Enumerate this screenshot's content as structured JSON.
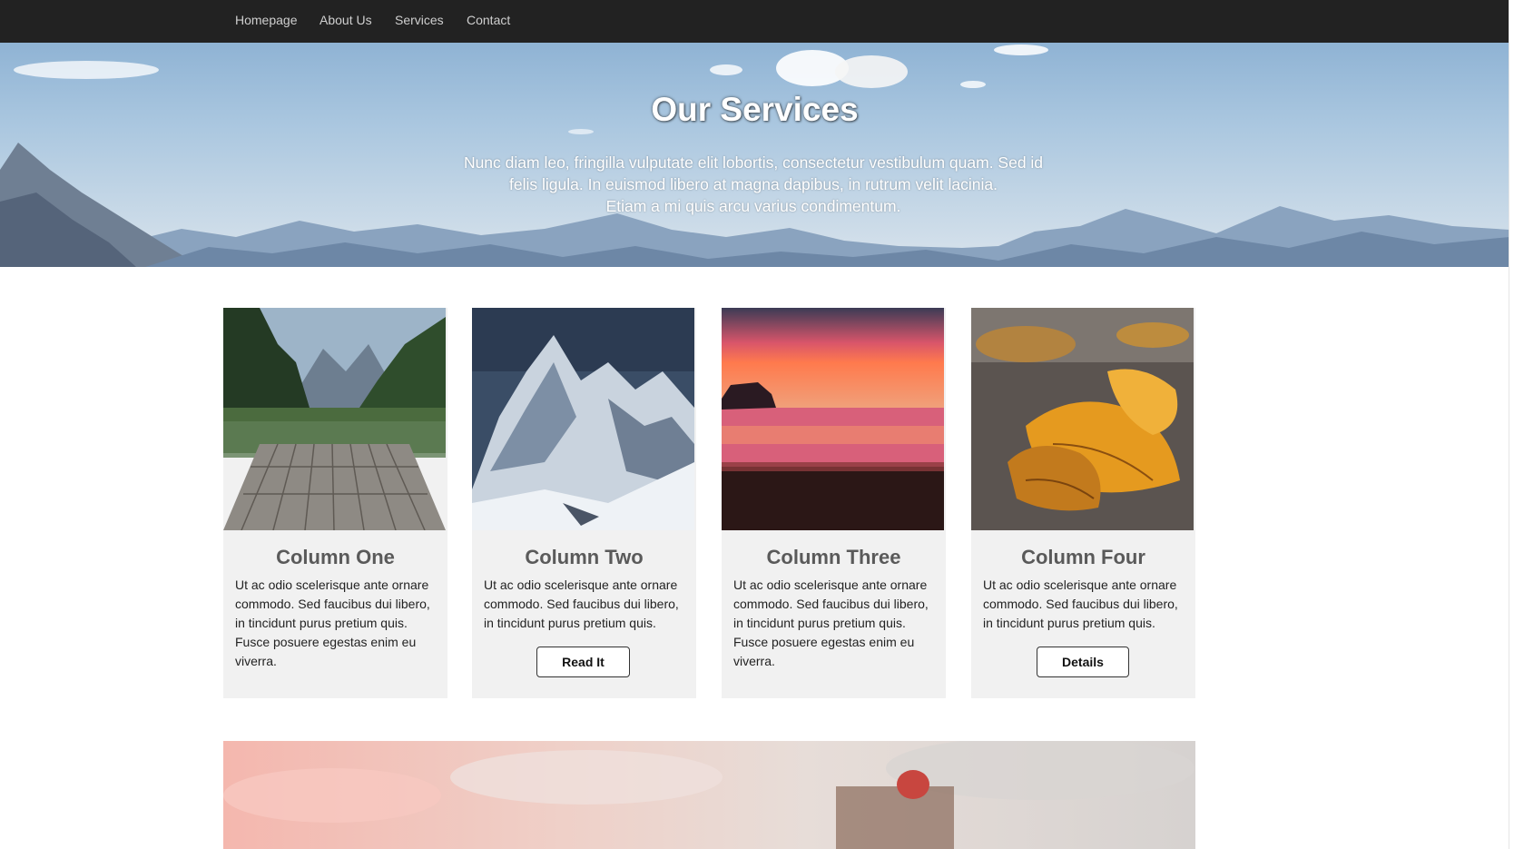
{
  "nav": {
    "items": [
      {
        "label": "Homepage"
      },
      {
        "label": "About Us"
      },
      {
        "label": "Services"
      },
      {
        "label": "Contact"
      }
    ]
  },
  "hero": {
    "title": "Our Services",
    "lines": [
      "Nunc diam leo, fringilla vulputate elit lobortis, consectetur vestibulum quam. Sed id",
      "felis ligula. In euismod libero at magna dapibus, in rutrum velit lacinia.",
      "Etiam a mi quis arcu varius condimentum."
    ]
  },
  "columns": [
    {
      "title": "Column One",
      "text": "Ut ac odio scelerisque ante ornare commodo. Sed faucibus dui libero, in tincidunt purus pretium quis. Fusce posuere egestas enim eu viverra.",
      "image": "lake-pier-forest-photo"
    },
    {
      "title": "Column Two",
      "text": "Ut ac odio scelerisque ante ornare commodo. Sed faucibus dui libero, in tincidunt purus pretium quis.",
      "button": "Read It",
      "image": "snowy-mountain-photo"
    },
    {
      "title": "Column Three",
      "text": "Ut ac odio scelerisque ante ornare commodo. Sed faucibus dui libero, in tincidunt purus pretium quis. Fusce posuere egestas enim eu viverra.",
      "image": "sunset-beach-photo"
    },
    {
      "title": "Column Four",
      "text": "Ut ac odio scelerisque ante ornare commodo. Sed faucibus dui libero, in tincidunt purus pretium quis.",
      "button": "Details",
      "image": "autumn-leaves-photo"
    }
  ],
  "colors": {
    "nav_bg": "#222222",
    "nav_text": "#cfcfcf",
    "card_bg": "#f1f1f1",
    "heading": "#5a5a5a"
  }
}
